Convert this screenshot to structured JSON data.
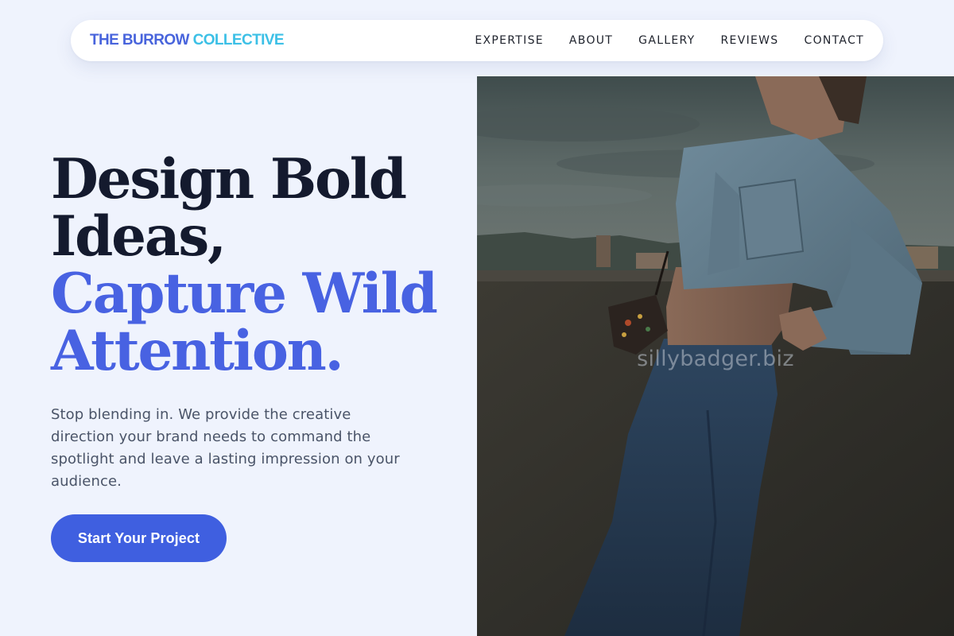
{
  "brand": {
    "name_part_a": "THE BURROW",
    "name_part_b": "COLLECTIVE",
    "color_primary": "#4864dc",
    "color_secondary": "#3cc0e6"
  },
  "nav": {
    "links": [
      {
        "label": "EXPERTISE"
      },
      {
        "label": "ABOUT"
      },
      {
        "label": "GALLERY"
      },
      {
        "label": "REVIEWS"
      },
      {
        "label": "CONTACT"
      }
    ]
  },
  "hero": {
    "headline_line1": "Design Bold",
    "headline_line2": "Ideas,",
    "headline_line3": "Capture Wild",
    "headline_line4": "Attention.",
    "subcopy": "Stop blending in. We provide the creative direction your brand needs to command the spotlight and leave a lasting impression on your audience.",
    "cta_label": "Start Your Project",
    "accent_color": "#4862e2"
  },
  "image": {
    "watermark": "sillybadger.biz",
    "subject": "photo-woman-denim-jacket-rooftop"
  }
}
